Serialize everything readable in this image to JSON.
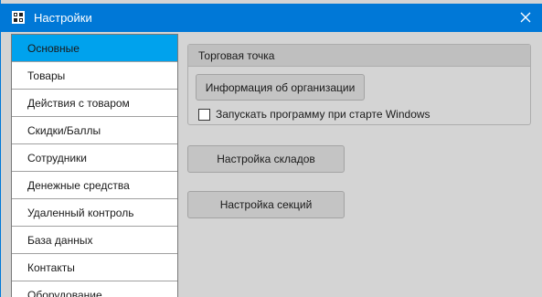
{
  "window": {
    "title": "Настройки",
    "accent_color": "#0078d7",
    "icon": "app-grid-icon",
    "close_icon": "close-icon"
  },
  "background_fragment": "e",
  "sidebar": {
    "active_color": "#00a2ed",
    "items": [
      {
        "label": "Основные",
        "active": true
      },
      {
        "label": "Товары",
        "active": false
      },
      {
        "label": "Действия с товаром",
        "active": false
      },
      {
        "label": "Скидки/Баллы",
        "active": false
      },
      {
        "label": "Сотрудники",
        "active": false
      },
      {
        "label": "Денежные средства",
        "active": false
      },
      {
        "label": "Удаленный контроль",
        "active": false
      },
      {
        "label": "База данных",
        "active": false
      },
      {
        "label": "Контакты",
        "active": false
      },
      {
        "label": "Оборудование",
        "active": false
      }
    ]
  },
  "main": {
    "group": {
      "title": "Торговая точка",
      "org_button": "Информация об организации",
      "startup_checkbox": {
        "label": "Запускать программу при старте Windows",
        "checked": false
      }
    },
    "warehouses_button": "Настройка складов",
    "sections_button": "Настройка секций"
  }
}
